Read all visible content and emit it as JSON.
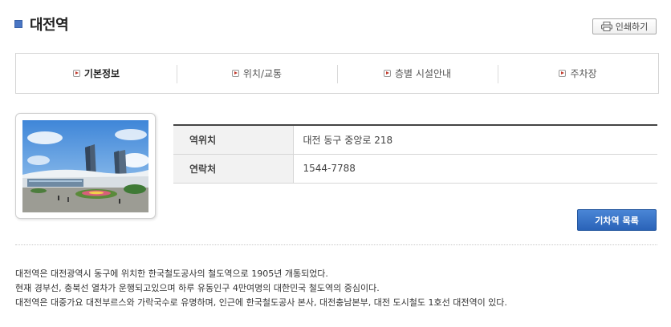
{
  "header": {
    "title": "대전역",
    "print_label": "인쇄하기"
  },
  "tabs": [
    {
      "label": "기본정보",
      "active": true
    },
    {
      "label": "위치/교통",
      "active": false
    },
    {
      "label": "층별 시설안내",
      "active": false
    },
    {
      "label": "주차장",
      "active": false
    }
  ],
  "info": {
    "rows": [
      {
        "label": "역위치",
        "value": "대전 동구 중앙로 218"
      },
      {
        "label": "연락처",
        "value": "1544-7788"
      }
    ]
  },
  "list_button_label": "기차역 목록",
  "description": [
    "대전역은 대전광역시 동구에 위치한 한국철도공사의 철도역으로 1905년 개통되었다.",
    "현재 경부선, 충북선 열차가 운행되고있으며 하루 유동인구 4만여명의 대한민국 철도역의 중심이다.",
    "대전역은 대중가요 대전부르스와 가락국수로 유명하며, 인근에 한국철도공사 본사, 대전충남본부, 대전 도시철도 1호선 대전역이 있다."
  ],
  "colors": {
    "accent": "#4a76c4",
    "button_blue": "#2a63b8",
    "tab_arrow": "#c0392b"
  }
}
